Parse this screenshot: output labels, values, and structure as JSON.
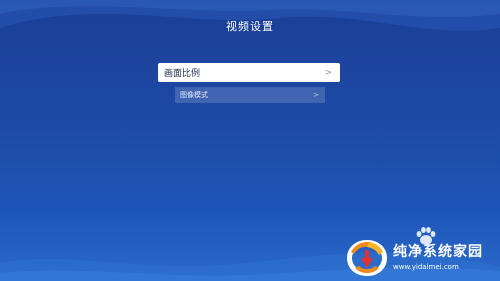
{
  "header": {
    "title": "视频设置"
  },
  "menu": {
    "items": [
      {
        "label": "画面比例",
        "selected": true
      },
      {
        "label": "图像模式",
        "selected": false
      }
    ]
  },
  "watermark": {
    "name": "纯净系统家园",
    "url": "www.yidaimei.com"
  },
  "colors": {
    "background_top": "#1a3f96",
    "background_bottom": "#2a6ac8",
    "selected_bg": "#ffffff",
    "logo_orange": "#f08a1c",
    "logo_red": "#e5322d"
  }
}
